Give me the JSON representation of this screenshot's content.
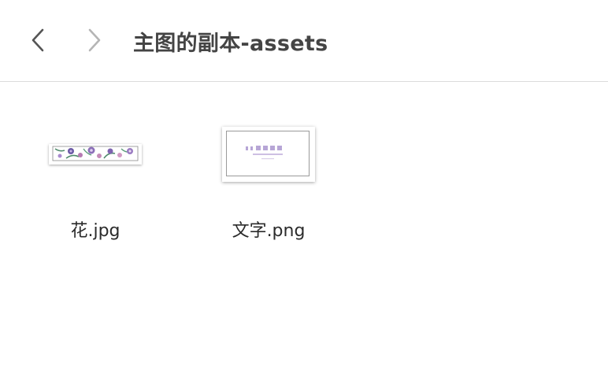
{
  "window": {
    "title": "主图的副本-assets"
  },
  "navigation": {
    "back_icon": "chevron-left-icon",
    "forward_icon": "chevron-right-icon",
    "back_enabled": true,
    "forward_enabled": false
  },
  "files": [
    {
      "name": "花.jpg",
      "thumbnail": "flower-banner"
    },
    {
      "name": "文字.png",
      "thumbnail": "text-card"
    }
  ],
  "colors": {
    "title": "#444444",
    "back_arrow": "#555555",
    "forward_arrow": "#b5b5b5",
    "divider": "#dcdcdc"
  }
}
